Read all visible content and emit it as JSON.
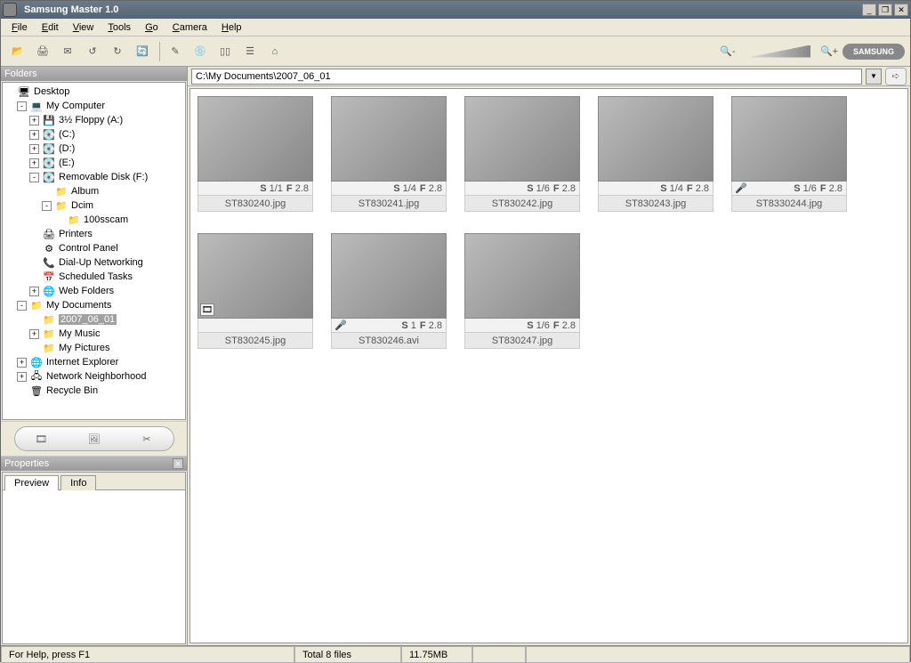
{
  "title": "Samsung Master 1.0",
  "menus": [
    "File",
    "Edit",
    "View",
    "Tools",
    "Go",
    "Camera",
    "Help"
  ],
  "brand": "SAMSUNG",
  "folders_hdr": "Folders",
  "properties_hdr": "Properties",
  "tree": [
    {
      "d": 0,
      "exp": "",
      "ic": "🖥",
      "label": "Desktop"
    },
    {
      "d": 1,
      "exp": "-",
      "ic": "💻",
      "label": "My Computer"
    },
    {
      "d": 2,
      "exp": "+",
      "ic": "💾",
      "label": "3½ Floppy (A:)"
    },
    {
      "d": 2,
      "exp": "+",
      "ic": "💽",
      "label": "(C:)"
    },
    {
      "d": 2,
      "exp": "+",
      "ic": "💽",
      "label": "(D:)"
    },
    {
      "d": 2,
      "exp": "+",
      "ic": "💽",
      "label": "(E:)"
    },
    {
      "d": 2,
      "exp": "-",
      "ic": "💽",
      "label": "Removable Disk (F:)"
    },
    {
      "d": 3,
      "exp": "",
      "ic": "📁",
      "label": "Album"
    },
    {
      "d": 3,
      "exp": "-",
      "ic": "📁",
      "label": "Dcim"
    },
    {
      "d": 4,
      "exp": "",
      "ic": "📁",
      "label": "100sscam"
    },
    {
      "d": 2,
      "exp": "",
      "ic": "🖨",
      "label": "Printers"
    },
    {
      "d": 2,
      "exp": "",
      "ic": "⚙",
      "label": "Control Panel"
    },
    {
      "d": 2,
      "exp": "",
      "ic": "📞",
      "label": "Dial-Up Networking"
    },
    {
      "d": 2,
      "exp": "",
      "ic": "📅",
      "label": "Scheduled Tasks"
    },
    {
      "d": 2,
      "exp": "+",
      "ic": "🌐",
      "label": "Web Folders"
    },
    {
      "d": 1,
      "exp": "-",
      "ic": "📁",
      "label": "My Documents"
    },
    {
      "d": 2,
      "exp": "",
      "ic": "📁",
      "label": "2007_06_01",
      "sel": true
    },
    {
      "d": 2,
      "exp": "+",
      "ic": "📁",
      "label": "My Music"
    },
    {
      "d": 2,
      "exp": "",
      "ic": "📁",
      "label": "My Pictures"
    },
    {
      "d": 1,
      "exp": "+",
      "ic": "🌐",
      "label": "Internet Explorer"
    },
    {
      "d": 1,
      "exp": "+",
      "ic": "🖧",
      "label": "Network Neighborhood"
    },
    {
      "d": 1,
      "exp": "",
      "ic": "🗑",
      "label": "Recycle Bin"
    }
  ],
  "tabs": {
    "preview": "Preview",
    "info": "Info"
  },
  "path": "C:\\My Documents\\2007_06_01",
  "thumbs": [
    {
      "s": "1/1",
      "f": "2.8",
      "name": "ST830240.jpg",
      "corner": ""
    },
    {
      "s": "1/4",
      "f": "2.8",
      "name": "ST830241.jpg",
      "corner": ""
    },
    {
      "s": "1/6",
      "f": "2.8",
      "name": "ST830242.jpg",
      "corner": ""
    },
    {
      "s": "1/4",
      "f": "2.8",
      "name": "ST830243.jpg",
      "corner": ""
    },
    {
      "s": "1/6",
      "f": "2.8",
      "name": "ST8330244.jpg",
      "corner": "",
      "mic": "🎤"
    },
    {
      "s": "",
      "f": "",
      "name": "ST830245.jpg",
      "corner": "🎞"
    },
    {
      "s": "  1",
      "f": "2.8",
      "name": "ST830246.avi",
      "corner": "",
      "mic": "🎤"
    },
    {
      "s": "1/6",
      "f": "2.8",
      "name": "ST830247.jpg",
      "corner": ""
    }
  ],
  "labels": {
    "s": "S",
    "f": "F"
  },
  "status": {
    "help": "For Help, press F1",
    "total": "Total 8 files",
    "size": "11.75MB"
  }
}
